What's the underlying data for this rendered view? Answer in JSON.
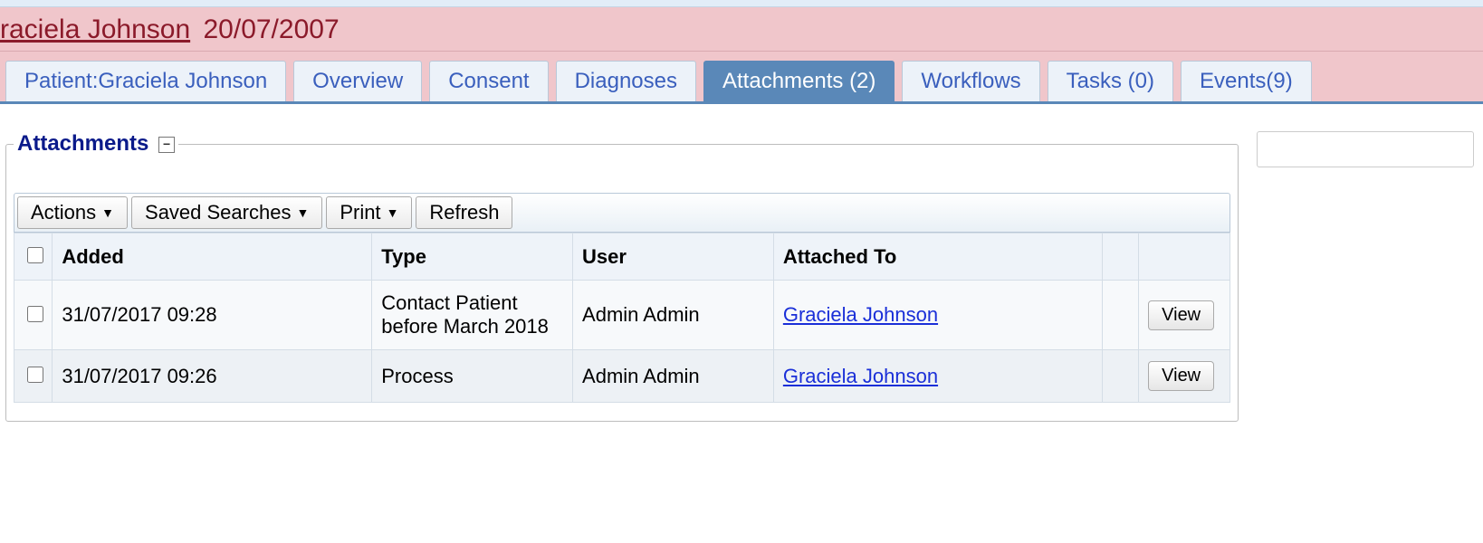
{
  "patient": {
    "name": "raciela Johnson",
    "dob": "20/07/2007"
  },
  "tabs": [
    {
      "label": "Patient:Graciela Johnson"
    },
    {
      "label": "Overview"
    },
    {
      "label": "Consent"
    },
    {
      "label": "Diagnoses"
    },
    {
      "label": "Attachments (2)"
    },
    {
      "label": "Workflows"
    },
    {
      "label": "Tasks (0)"
    },
    {
      "label": "Events(9)"
    }
  ],
  "section": {
    "title": "Attachments",
    "collapse_symbol": "−"
  },
  "toolbar": {
    "actions": "Actions",
    "saved_searches": "Saved Searches",
    "print": "Print",
    "refresh": "Refresh"
  },
  "table": {
    "headers": {
      "added": "Added",
      "type": "Type",
      "user": "User",
      "attached_to": "Attached To"
    },
    "rows": [
      {
        "added": "31/07/2017 09:28",
        "type": "Contact Patient before March 2018",
        "user": "Admin Admin",
        "attached_to": "Graciela Johnson",
        "action": "View"
      },
      {
        "added": "31/07/2017 09:26",
        "type": "Process",
        "user": "Admin Admin",
        "attached_to": "Graciela Johnson",
        "action": "View"
      }
    ]
  }
}
